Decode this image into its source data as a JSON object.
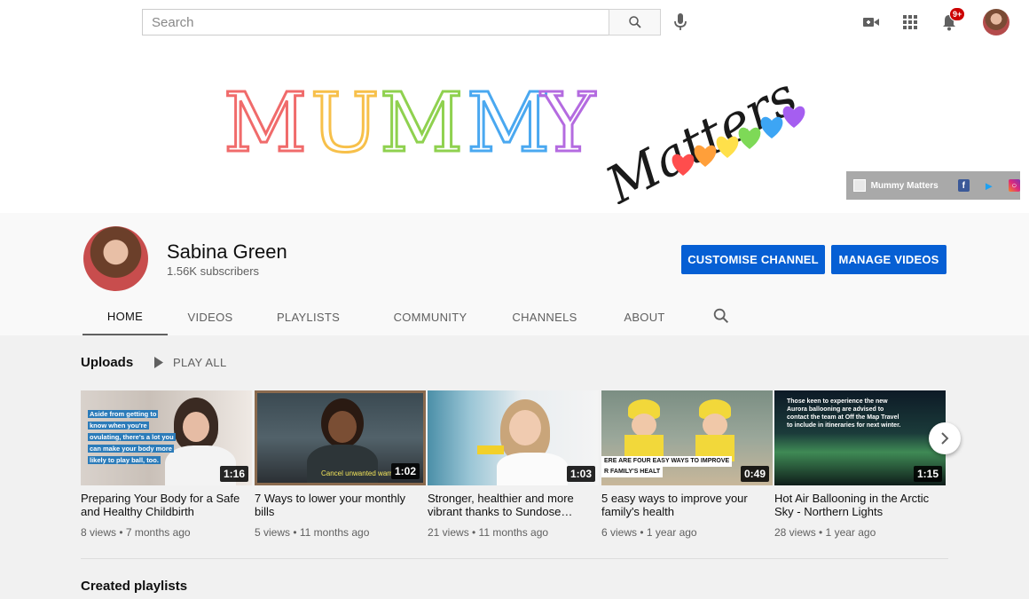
{
  "search": {
    "placeholder": "Search"
  },
  "topbar": {
    "notification_count": "9+"
  },
  "banner": {
    "mummy_letters": [
      "M",
      "U",
      "M",
      "M",
      "Y"
    ],
    "mummy_colors": [
      "#f06b6b",
      "#f7c04a",
      "#8fd14f",
      "#4aa8f0",
      "#b46be0"
    ],
    "matters_text": "Matters",
    "heart_colors": [
      "#ff4d4d",
      "#ff9f3a",
      "#ffe04a",
      "#7ed957",
      "#3da5f4",
      "#a55ef0"
    ],
    "links_label": "Mummy Matters"
  },
  "channel": {
    "name": "Sabina Green",
    "subscribers": "1.56K subscribers",
    "customise_label": "CUSTOMISE CHANNEL",
    "manage_label": "MANAGE VIDEOS"
  },
  "tabs": [
    "HOME",
    "VIDEOS",
    "PLAYLISTS",
    "COMMUNITY",
    "CHANNELS",
    "ABOUT"
  ],
  "uploads": {
    "title": "Uploads",
    "play_all": "PLAY ALL",
    "videos": [
      {
        "title": "Preparing Your Body for a Safe and Healthy Childbirth",
        "meta": "8 views • 7 months ago",
        "duration": "1:16",
        "overlay": [
          "Aside from getting to",
          "know when you're",
          "ovulating, there's a lot you",
          "can make your body more",
          "likely to play ball, too."
        ]
      },
      {
        "title": "7 Ways to lower your monthly bills",
        "meta": "5 views • 11 months ago",
        "duration": "1:02",
        "overlay": [
          "Cancel unwanted warr"
        ]
      },
      {
        "title": "Stronger, healthier and more vibrant thanks to Sundose…",
        "meta": "21 views • 11 months ago",
        "duration": "1:03",
        "overlay": []
      },
      {
        "title": "5 easy ways to improve your family's health",
        "meta": "6 views • 1 year ago",
        "duration": "0:49",
        "overlay": [
          "ERE ARE FOUR EASY WAYS TO IMPROVE",
          "R FAMILY'S HEALT"
        ]
      },
      {
        "title": "Hot Air Ballooning in the Arctic Sky - Northern Lights",
        "meta": "28 views • 1 year ago",
        "duration": "1:15",
        "overlay": [
          "Those keen to experience the new",
          "Aurora ballooning are advised to",
          "contact the team at Off the Map Travel",
          "to include in itineraries for next winter."
        ]
      }
    ]
  },
  "playlists": {
    "title": "Created playlists"
  }
}
